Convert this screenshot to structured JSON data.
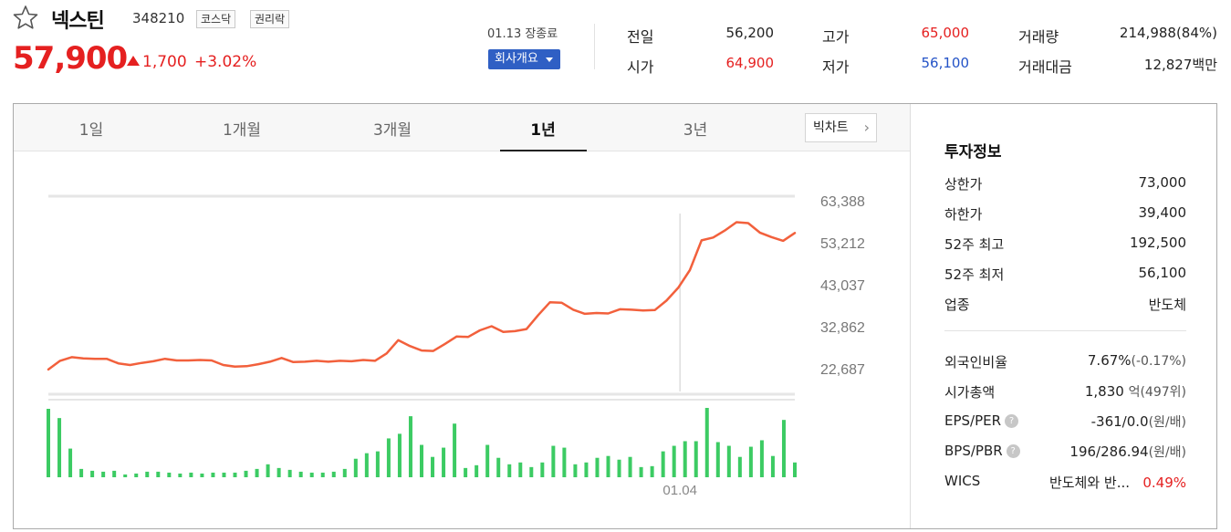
{
  "stock": {
    "name": "넥스틴",
    "code": "348210",
    "market_tag": "코스닥",
    "rights_tag": "권리락",
    "price": "57,900",
    "change": "1,700",
    "change_pct": "+3.02%",
    "status": "01.13 장종료",
    "company_button": "회사개요"
  },
  "stats": {
    "prev_close_label": "전일",
    "prev_close": "56,200",
    "open_label": "시가",
    "open": "64,900",
    "high_label": "고가",
    "high": "65,000",
    "low_label": "저가",
    "low": "56,100",
    "volume_label": "거래량",
    "volume": "214,988(84%)",
    "amount_label": "거래대금",
    "amount": "12,827백만"
  },
  "tabs": [
    "1일",
    "1개월",
    "3개월",
    "1년",
    "3년"
  ],
  "active_tab": "1년",
  "big_chart_label": "빅차트",
  "info": {
    "title": "투자정보",
    "upper_limit_label": "상한가",
    "upper_limit": "73,000",
    "lower_limit_label": "하한가",
    "lower_limit": "39,400",
    "high52_label": "52주 최고",
    "high52": "192,500",
    "low52_label": "52주 최저",
    "low52": "56,100",
    "sector_label": "업종",
    "sector": "반도체",
    "foreign_label": "외국인비율",
    "foreign": "7.67%",
    "foreign_change": "(-0.17%)",
    "marketcap_label": "시가총액",
    "marketcap": "1,830",
    "marketcap_unit": "억(497위)",
    "eps_label": "EPS/PER",
    "eps": "-361/0.0",
    "eps_unit": "(원/배)",
    "bps_label": "BPS/PBR",
    "bps": "196/286.94",
    "bps_unit": "(원/배)",
    "wics_label": "WICS",
    "wics": "반도체와 반...",
    "wics_pct": "0.49%"
  },
  "colors": {
    "up": "#e52020",
    "down": "#2453c7",
    "line": "#f2603c",
    "volume": "#3ccb63"
  },
  "chart_data": {
    "type": "line",
    "y_tick_labels": [
      "63,388",
      "53,212",
      "43,037",
      "32,862",
      "22,687"
    ],
    "ylim": [
      22687,
      63388
    ],
    "x_tick_labels": [
      "01.04"
    ],
    "x_tick_index": 54,
    "grid": true,
    "series": [
      {
        "type": "line",
        "values": [
          22700,
          24800,
          25700,
          25400,
          25300,
          25300,
          24200,
          23800,
          24300,
          24700,
          25300,
          24900,
          24900,
          25000,
          24900,
          23800,
          23400,
          23500,
          24000,
          24600,
          25500,
          24500,
          24600,
          24800,
          24600,
          24800,
          24700,
          25000,
          24800,
          26600,
          29800,
          28400,
          27300,
          27200,
          28900,
          30700,
          30600,
          32200,
          33200,
          31800,
          32000,
          32500,
          35900,
          39000,
          38900,
          37200,
          36200,
          36400,
          36300,
          37300,
          37200,
          37000,
          37100,
          39400,
          42500,
          46800,
          54000,
          54700,
          56400,
          58400,
          58200,
          55900,
          54800,
          53900,
          55800
        ]
      },
      {
        "type": "bar",
        "name": "volume",
        "values": [
          74,
          64,
          31,
          9,
          7,
          6,
          7,
          3,
          4,
          6,
          6,
          5,
          4,
          5,
          4,
          5,
          5,
          5,
          7,
          9,
          14,
          10,
          8,
          6,
          5,
          5,
          6,
          9,
          20,
          26,
          28,
          42,
          47,
          66,
          35,
          22,
          32,
          58,
          10,
          13,
          35,
          21,
          14,
          16,
          11,
          16,
          34,
          32,
          14,
          16,
          21,
          23,
          19,
          22,
          11,
          12,
          28,
          34,
          39,
          39,
          75,
          38,
          34,
          22,
          33,
          40,
          23,
          62,
          16
        ]
      }
    ]
  }
}
